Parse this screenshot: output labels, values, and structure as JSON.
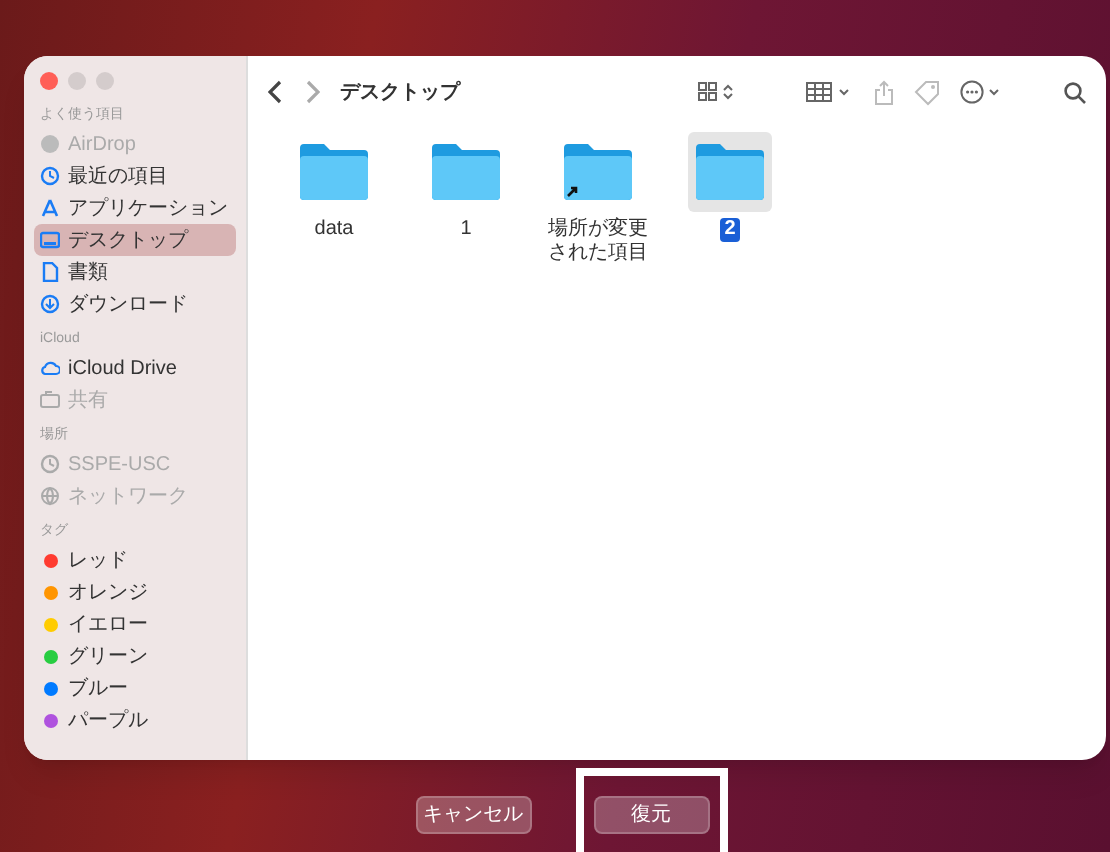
{
  "sidebar": {
    "sections": [
      {
        "title": "よく使う項目",
        "items": [
          {
            "label": "AirDrop",
            "kind": "airdrop",
            "disabled": true,
            "selected": false
          },
          {
            "label": "最近の項目",
            "kind": "recent",
            "disabled": false,
            "selected": false
          },
          {
            "label": "アプリケーション",
            "kind": "apps",
            "disabled": false,
            "selected": false
          },
          {
            "label": "デスクトップ",
            "kind": "desktop",
            "disabled": false,
            "selected": true
          },
          {
            "label": "書類",
            "kind": "documents",
            "disabled": false,
            "selected": false
          },
          {
            "label": "ダウンロード",
            "kind": "downloads",
            "disabled": false,
            "selected": false
          }
        ]
      },
      {
        "title": "iCloud",
        "items": [
          {
            "label": "iCloud Drive",
            "kind": "cloud",
            "disabled": false,
            "selected": false
          },
          {
            "label": "共有",
            "kind": "shared",
            "disabled": true,
            "selected": false
          }
        ]
      },
      {
        "title": "場所",
        "items": [
          {
            "label": "SSPE-USC",
            "kind": "disk",
            "disabled": true,
            "selected": false
          },
          {
            "label": "ネットワーク",
            "kind": "network",
            "disabled": true,
            "selected": false
          }
        ]
      },
      {
        "title": "タグ",
        "items": [
          {
            "label": "レッド",
            "kind": "tag",
            "color": "#ff3b30",
            "disabled": false,
            "selected": false
          },
          {
            "label": "オレンジ",
            "kind": "tag",
            "color": "#ff9500",
            "disabled": false,
            "selected": false
          },
          {
            "label": "イエロー",
            "kind": "tag",
            "color": "#ffcc00",
            "disabled": false,
            "selected": false
          },
          {
            "label": "グリーン",
            "kind": "tag",
            "color": "#28cd41",
            "disabled": false,
            "selected": false
          },
          {
            "label": "ブルー",
            "kind": "tag",
            "color": "#007aff",
            "disabled": false,
            "selected": false
          },
          {
            "label": "パープル",
            "kind": "tag",
            "color": "#af52de",
            "disabled": false,
            "selected": false
          }
        ]
      }
    ]
  },
  "toolbar": {
    "title": "デスクトップ"
  },
  "files": [
    {
      "name": "data",
      "alias": false,
      "selected": false
    },
    {
      "name": "1",
      "alias": false,
      "selected": false
    },
    {
      "name": "場所が変更された項目",
      "alias": true,
      "selected": false
    },
    {
      "name": "2",
      "alias": false,
      "selected": true
    }
  ],
  "buttons": [
    {
      "label": "キャンセル",
      "highlighted": false
    },
    {
      "label": "復元",
      "highlighted": true
    }
  ]
}
